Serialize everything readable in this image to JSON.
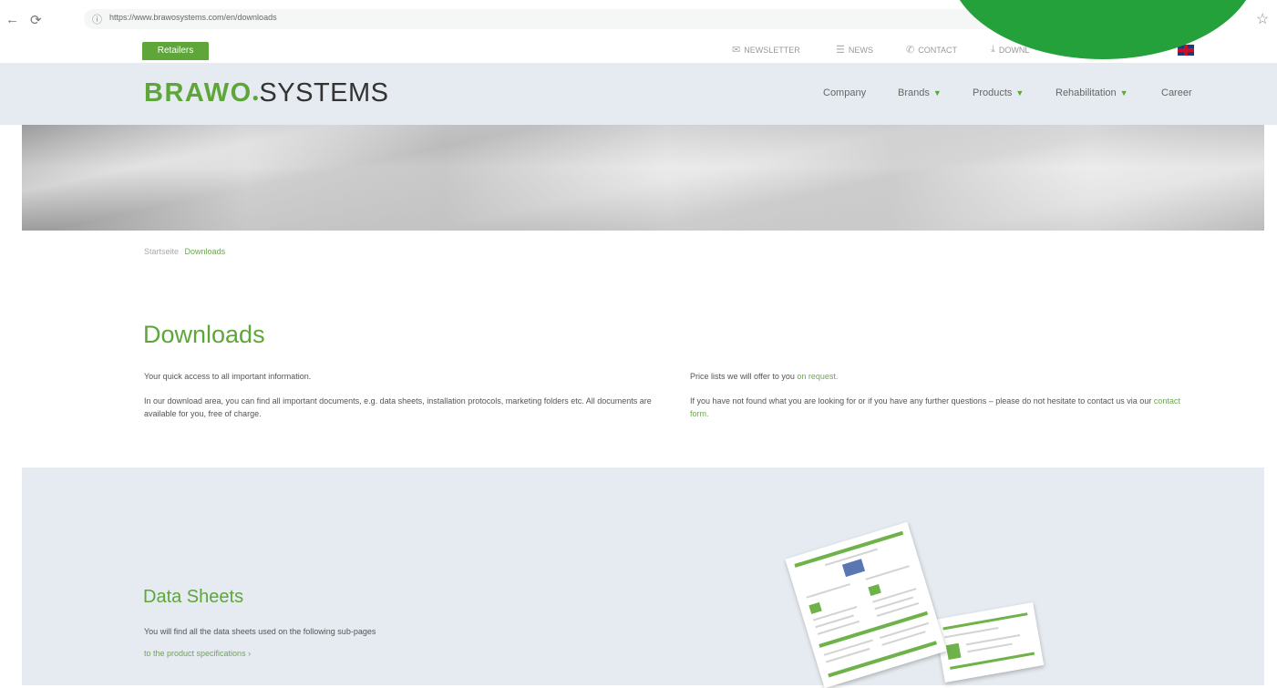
{
  "browser": {
    "url": "https://www.brawosystems.com/en/downloads"
  },
  "utility_bar": {
    "retailers": "Retailers",
    "newsletter": "NEWSLETTER",
    "news": "NEWS",
    "contact": "CONTACT",
    "downloads": "DOWNL"
  },
  "header": {
    "logo_brand": "BRAWO",
    "logo_rest": "SYSTEMS",
    "menu": [
      "Company",
      "Brands",
      "Products",
      "Rehabilitation",
      "Career"
    ]
  },
  "breadcrumb": {
    "home": "Startseite",
    "current": "Downloads"
  },
  "intro": {
    "title": "Downloads",
    "left_p1": "Your quick access to all important information.",
    "left_p2": "In our download area, you can find all important documents, e.g. data sheets, installation protocols, marketing folders etc. All documents are available for you, free of charge.",
    "right_p1_text": "Price lists we will offer to you ",
    "right_p1_link": "on request.",
    "right_p2_text": "If you have not found what you are looking for or if you have any further questions – please do not hesitate to contact us via our ",
    "right_p2_link": "contact form."
  },
  "data_sheets": {
    "title": "Data Sheets",
    "description": "You will find all the data sheets used on the following sub-pages",
    "link": "to the product specifications ›"
  },
  "colors": {
    "brand_green": "#5ea63a",
    "header_bg": "#e5ebf0",
    "blob_green": "#25a13b"
  }
}
